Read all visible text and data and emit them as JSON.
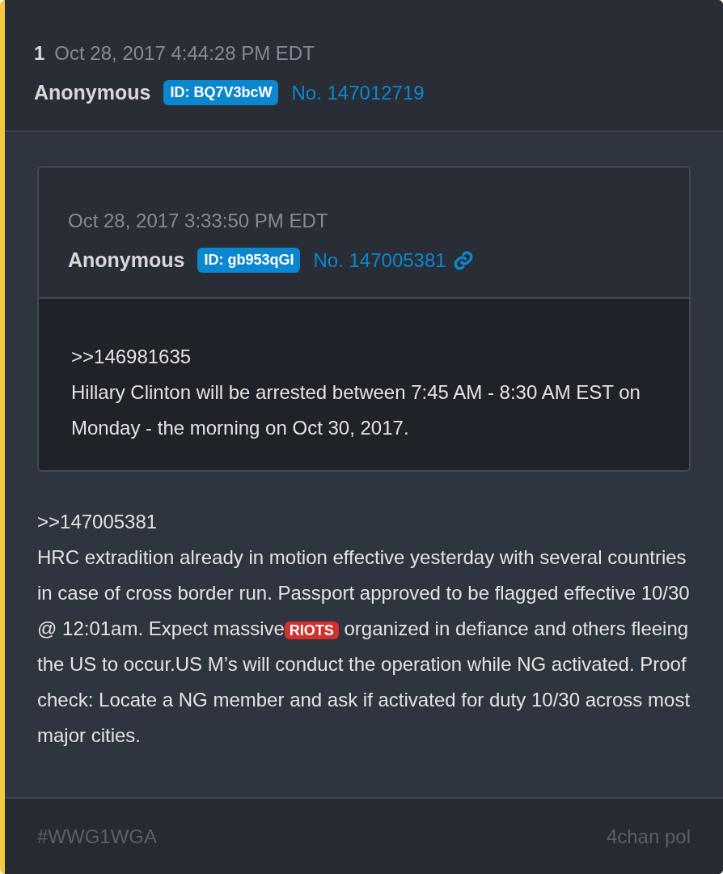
{
  "post": {
    "number": "1",
    "timestamp": "Oct 28, 2017 4:44:28 PM EDT",
    "author": "Anonymous",
    "id_badge": "ID: BQ7V3bcW",
    "post_no": "No. 147012719",
    "quote": {
      "timestamp": "Oct 28, 2017 3:33:50 PM EDT",
      "author": "Anonymous",
      "id_badge": "ID: gb953qGI",
      "post_no": "No. 147005381",
      "reference": ">>146981635",
      "text": "Hillary Clinton will be arrested between 7:45 AM - 8:30 AM EST on Monday - the morning on Oct 30, 2017."
    },
    "reference": ">>147005381",
    "segments": [
      {
        "kind": "text",
        "text": "HRC extradition already in motion effective yesterday with several countries in case of cross border run. Passport approved to be flagged effective 10/30 @ 12:01am. Expect massive"
      },
      {
        "kind": "tag",
        "text": "RIOTS"
      },
      {
        "kind": "text",
        "text": " organized in defiance and others fleeing the US to occur.US M’s will conduct the operation while NG activated. Proof check: Locate a NG member and ask if activated for duty 10/30 across most major cities."
      }
    ]
  },
  "footer": {
    "hashtag": "#WWG1WGA",
    "source": "4chan pol"
  }
}
